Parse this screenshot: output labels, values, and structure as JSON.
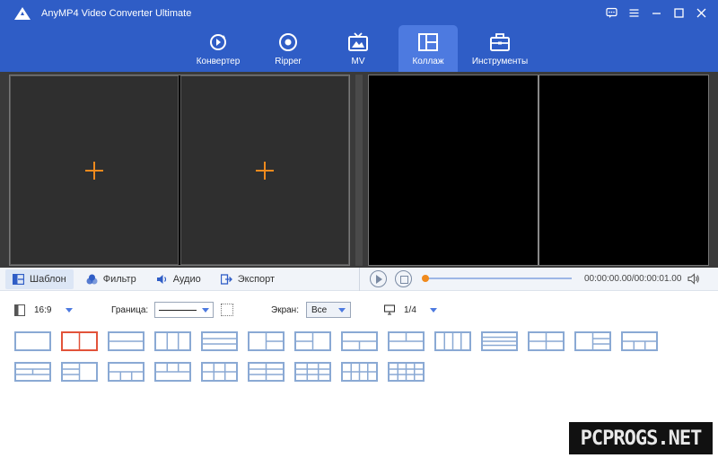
{
  "app": {
    "title": "AnyMP4 Video Converter Ultimate"
  },
  "window_controls": [
    {
      "name": "feedback-icon"
    },
    {
      "name": "menu-icon"
    },
    {
      "name": "minimize-icon"
    },
    {
      "name": "maximize-icon"
    },
    {
      "name": "close-icon"
    }
  ],
  "tabs": [
    {
      "label": "Конвертер",
      "icon": "converter-icon"
    },
    {
      "label": "Ripper",
      "icon": "ripper-icon"
    },
    {
      "label": "MV",
      "icon": "mv-icon"
    },
    {
      "label": "Коллаж",
      "icon": "collage-icon",
      "active": true
    },
    {
      "label": "Инструменты",
      "icon": "toolbox-icon"
    }
  ],
  "option_tabs": [
    {
      "label": "Шаблон",
      "icon": "template-icon",
      "active": true
    },
    {
      "label": "Фильтр",
      "icon": "filter-icon"
    },
    {
      "label": "Аудио",
      "icon": "audio-icon"
    },
    {
      "label": "Экспорт",
      "icon": "export-icon"
    }
  ],
  "player": {
    "time": "00:00:00.00/00:00:01.00",
    "progress": 0
  },
  "settings": {
    "aspect": "16:9",
    "border_label": "Граница:",
    "screen_label": "Экран:",
    "screen_value": "Все",
    "page": "1/4"
  },
  "templates": {
    "count": 23,
    "selected_index": 1
  },
  "watermark": "PCPROGS.NET",
  "colors": {
    "header": "#2f5dc6",
    "active_tab": "#4d7ae0",
    "accent": "#f08a1d",
    "selected_template": "#e2533a"
  }
}
